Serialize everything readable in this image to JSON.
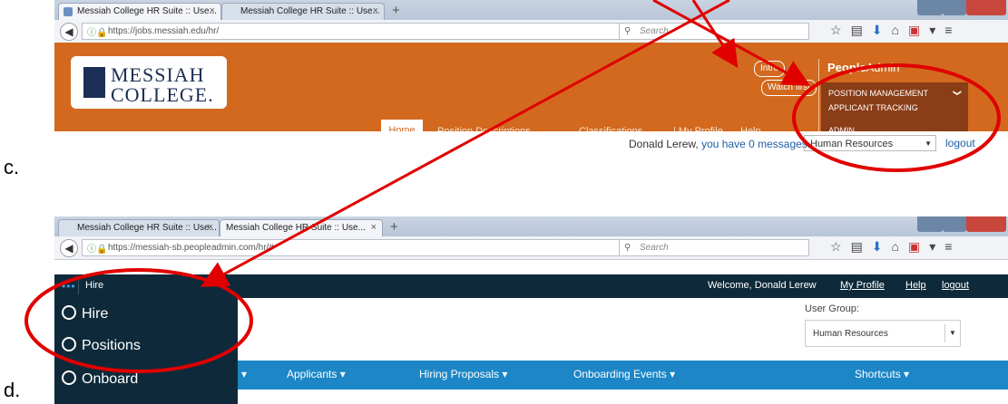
{
  "labels": {
    "c": "c.",
    "d": "d."
  },
  "browser_c": {
    "tabs": [
      {
        "title": "Messiah College HR Suite :: Use...",
        "close": "×"
      },
      {
        "title": "Messiah College HR Suite :: Use...",
        "close": "×"
      }
    ],
    "new_tab": "+",
    "url": "https://jobs.messiah.edu/hr/",
    "search_placeholder": "Search"
  },
  "page_c": {
    "logo_line1": "MESSIAH",
    "logo_line2": "COLLEGE.",
    "pill_intro": "Intro",
    "pill_watch": "Watch first",
    "brand_bold": "People",
    "brand_rest": "Admin",
    "dropdown": {
      "position_management": "POSITION MANAGEMENT",
      "chevron": "❯",
      "applicant_tracking": "APPLICANT TRACKING",
      "admin": "ADMIN"
    },
    "nav": {
      "home": "Home",
      "position_descriptions": "Position Descriptions",
      "classifications": "Classifications",
      "my_profile": "| My Profile",
      "help": "Help"
    },
    "message_user": "Donald Lerew, ",
    "message_link": "you have 0 messages.",
    "group_select": "Human Resources",
    "logout": "logout"
  },
  "browser_d": {
    "tabs": [
      {
        "title": "Messiah College HR Suite :: Use...",
        "close": "×"
      },
      {
        "title": "Messiah College HR Suite :: Use...",
        "close": "×"
      }
    ],
    "new_tab": "+",
    "url": "https://messiah-sb.peopleadmin.com/hr/#",
    "search_placeholder": "Search"
  },
  "page_d": {
    "dots": "•••",
    "top_label": "Hire",
    "welcome": "Welcome, Donald Lerew",
    "my_profile": "My Profile",
    "help": "Help",
    "logout": "logout",
    "menu": [
      "Hire",
      "Positions",
      "Onboard"
    ],
    "user_group_label": "User Group:",
    "user_group_value": "Human Resources",
    "nav": {
      "applicants": "Applicants ▾",
      "hiring_proposals": "Hiring Proposals ▾",
      "onboarding_events": "Onboarding Events ▾",
      "shortcuts": "Shortcuts ▾"
    }
  },
  "colors": {
    "annotation": "#e00000",
    "orange_header": "#d2691e",
    "dark_header": "#0e2a3a",
    "blue_nav": "#1c86c6"
  }
}
